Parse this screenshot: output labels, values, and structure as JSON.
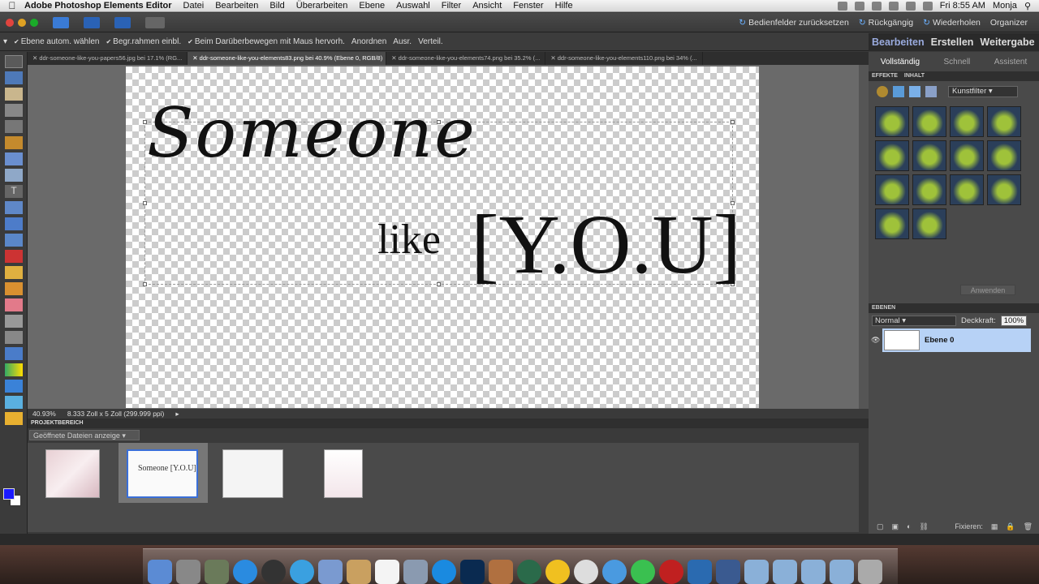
{
  "menubar": {
    "app": "Adobe Photoshop Elements Editor",
    "items": [
      "Datei",
      "Bearbeiten",
      "Bild",
      "Überarbeiten",
      "Ebene",
      "Auswahl",
      "Filter",
      "Ansicht",
      "Fenster",
      "Hilfe"
    ],
    "time": "Fri 8:55 AM",
    "user": "Monja"
  },
  "topbar": {
    "reset": "Bedienfelder zurücksetzen",
    "undo": "Rückgängig",
    "redo": "Wiederholen",
    "organizer": "Organizer"
  },
  "options": {
    "auto_select": "Ebene autom. wählen",
    "bounding": "Begr.rahmen einbl.",
    "hover": "Beim Darüberbewegen mit Maus hervorh.",
    "arrange": "Anordnen",
    "align": "Ausr.",
    "distribute": "Verteil."
  },
  "panel_tabs": [
    "Bearbeiten",
    "Erstellen",
    "Weitergabe"
  ],
  "panel_subtabs": [
    "Vollständig",
    "Schnell",
    "Assistent"
  ],
  "doc_tabs": [
    "ddr-someone-like-you-papers56.jpg bei 17.1% (RG...",
    "ddr-someone-like-you-elements83.png bei 40.9% (Ebene 0, RGB/8)",
    "ddr-someone-like-you-elements74.png bei 35.2% (...",
    "ddr-someone-like-you-elements110.png bei 34% (..."
  ],
  "canvas_text": {
    "line1": "Someone",
    "line2": "like",
    "line3": "[Y.O.U]"
  },
  "status": {
    "zoom": "40.93%",
    "size": "8.333 Zoll x 5 Zoll (299.999 ppi)"
  },
  "project": {
    "header": "PROJEKTBEREICH",
    "select": "Geöffnete Dateien anzeige"
  },
  "effects": {
    "header_effects": "EFFEKTE",
    "header_content": "INHALT",
    "filter_select": "Kunstfilter",
    "apply": "Anwenden"
  },
  "layers": {
    "header": "EBENEN",
    "mode": "Normal",
    "opacity_label": "Deckkraft:",
    "opacity": "100%",
    "layer_name": "Ebene 0",
    "lock_label": "Fixieren:"
  },
  "colors": {
    "foreground": "#1a1aff",
    "background": "#ffffff",
    "layer_selected": "#b7d2f6"
  }
}
